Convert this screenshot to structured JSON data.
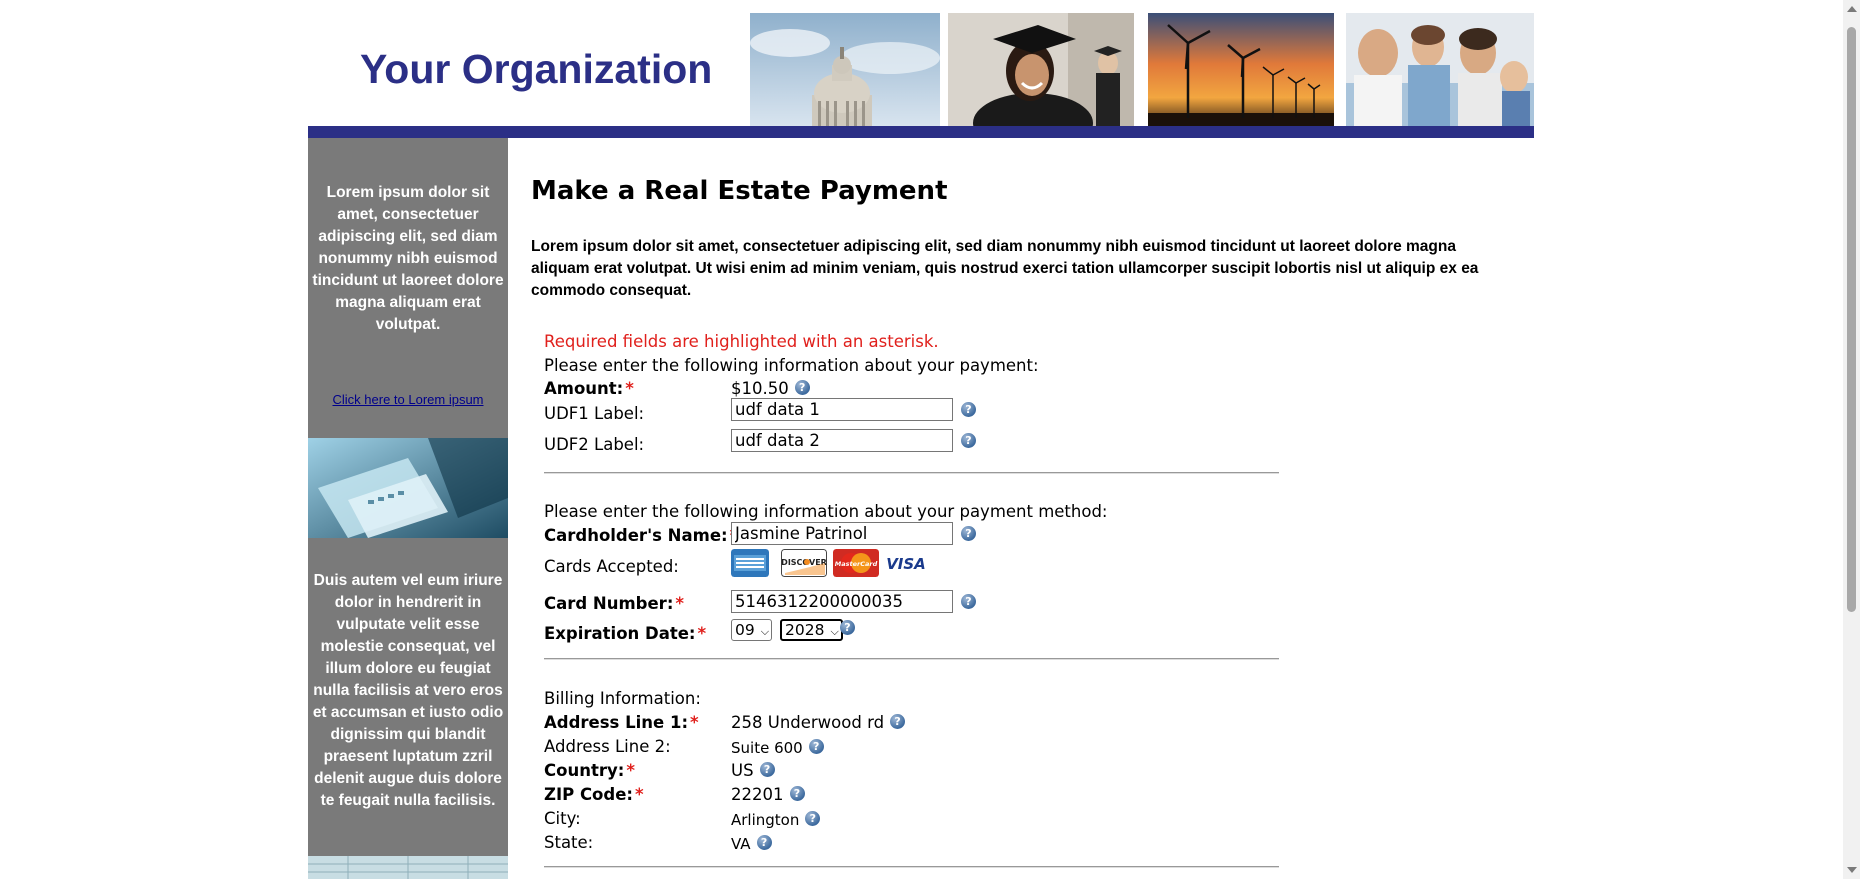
{
  "header": {
    "org_name": "Your Organization",
    "brand_color": "#2b2f86"
  },
  "sidebar": {
    "text1": "Lorem ipsum dolor sit amet, consectetuer adipiscing elit, sed diam nonummy nibh euismod tincidunt ut laoreet dolore magna aliquam erat volutpat.",
    "link": "Click here to Lorem ipsum",
    "text2": "Duis autem vel eum iriure dolor in hendrerit in vulputate velit esse molestie consequat, vel illum dolore eu feugiat nulla facilisis at vero eros et accumsan et iusto odio dignissim qui blandit praesent luptatum zzril delenit augue duis dolore te feugait nulla facilisis."
  },
  "main": {
    "title": "Make a Real Estate Payment",
    "intro": "Lorem ipsum dolor sit amet, consectetuer adipiscing elit, sed diam nonummy nibh euismod tincidunt ut laoreet dolore magna aliquam erat volutpat. Ut wisi enim ad minim veniam, quis nostrud exerci tation ullamcorper suscipit lobortis nisl ut aliquip ex ea commodo consequat."
  },
  "form": {
    "required_note": "Required fields are highlighted with an asterisk.",
    "asterisk": "*",
    "help_glyph": "?",
    "payment": {
      "heading": "Please enter the following information about your payment:",
      "amount_label": "Amount:",
      "amount_value": "$10.50",
      "udf1_label": "UDF1 Label:",
      "udf1_value": "udf data 1",
      "udf2_label": "UDF2 Label:",
      "udf2_value": "udf data 2"
    },
    "method": {
      "heading": "Please enter the following information about your payment method:",
      "cardholder_label": "Cardholder's Name:",
      "cardholder_value": "Jasmine Patrinol",
      "cards_label": "Cards Accepted:",
      "cards": [
        "American Express",
        "DISCOVER",
        "MasterCard",
        "VISA"
      ],
      "card_number_label": "Card Number:",
      "card_number_value": "5146312200000035",
      "expiration_label": "Expiration Date:",
      "exp_month": "09",
      "exp_year": "2028"
    },
    "billing": {
      "heading": "Billing Information:",
      "address1_label": "Address Line 1:",
      "address1_value": "258 Underwood rd",
      "address2_label": "Address Line 2:",
      "address2_value": "Suite 600",
      "country_label": "Country:",
      "country_value": "US",
      "zip_label": "ZIP Code:",
      "zip_value": "22201",
      "city_label": "City:",
      "city_value": "Arlington",
      "state_label": "State:",
      "state_value": "VA"
    }
  }
}
